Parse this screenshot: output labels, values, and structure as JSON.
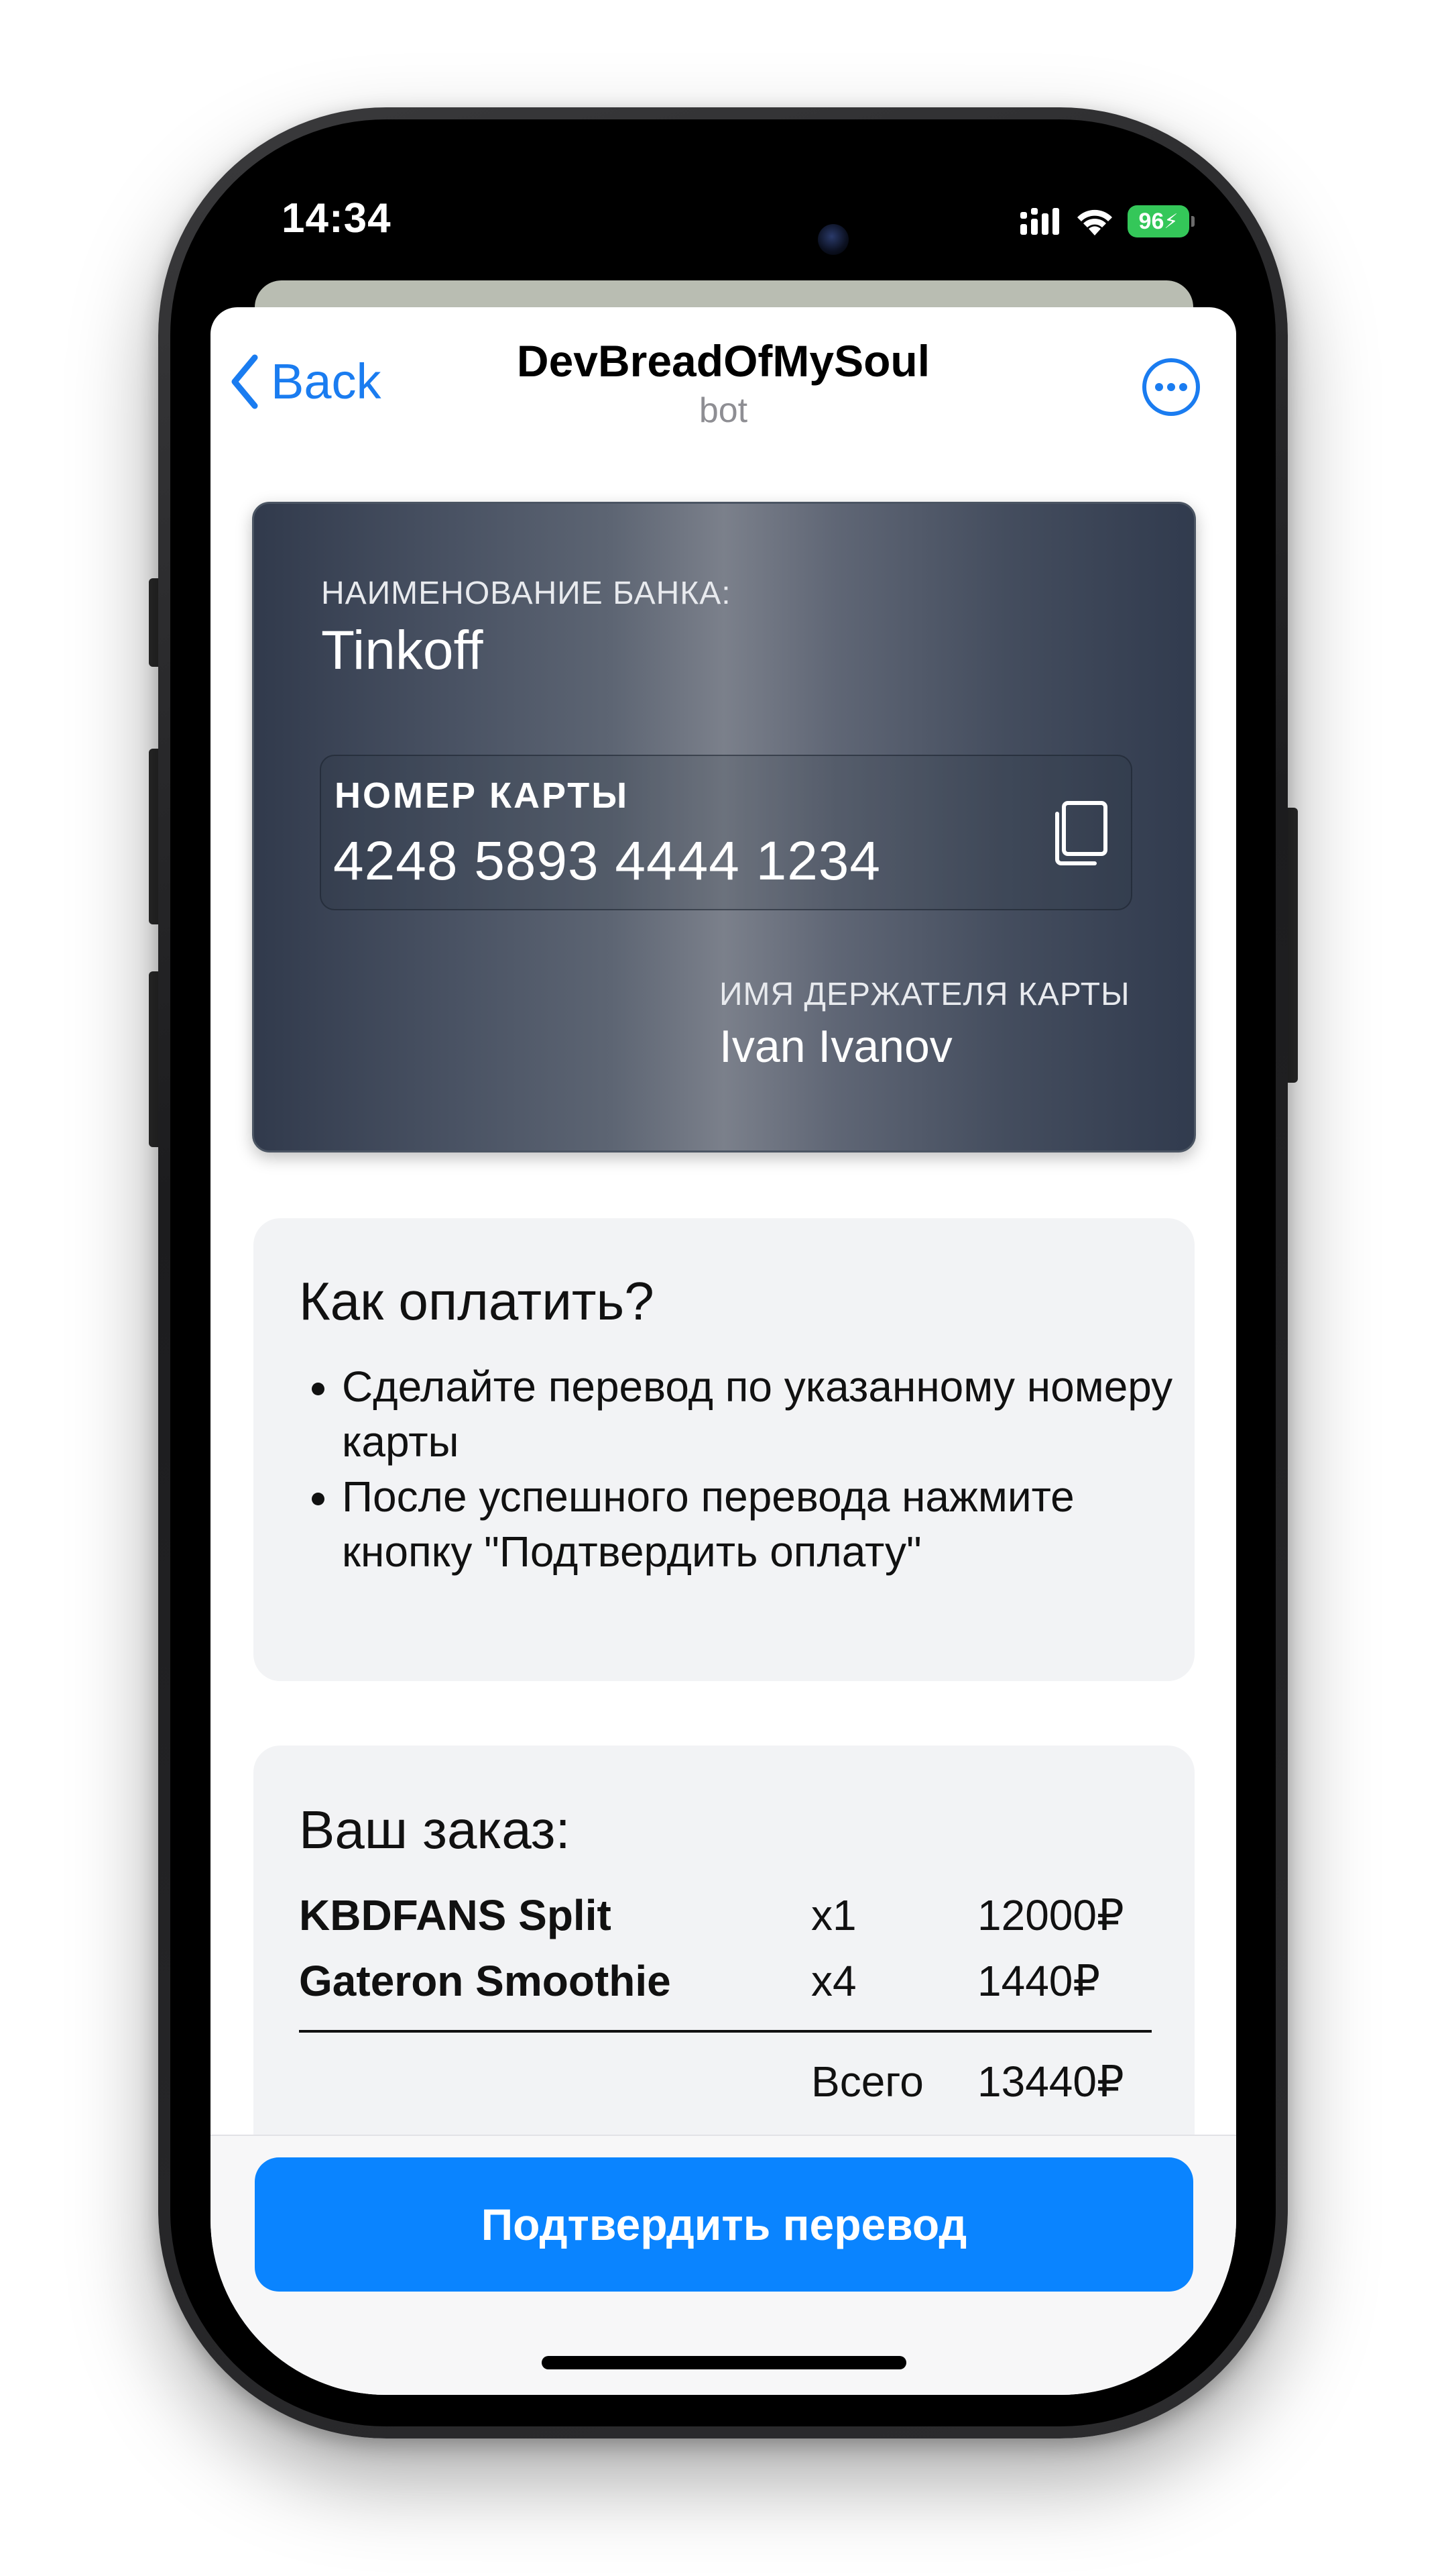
{
  "status_bar": {
    "time": "14:34",
    "battery": "96"
  },
  "header": {
    "back_label": "Back",
    "title": "DevBreadOfMySoul",
    "subtitle": "bot"
  },
  "card": {
    "bank_label": "НАИМЕНОВАНИЕ БАНКА:",
    "bank_name": "Tinkoff",
    "number_label": "НОМЕР КАРТЫ",
    "number": "4248 5893 4444 1234",
    "holder_label": "ИМЯ ДЕРЖАТЕЛЯ КАРТЫ",
    "holder_name": "Ivan Ivanov"
  },
  "how_to_pay": {
    "title": "Как оплатить?",
    "steps": [
      "Сделайте перевод по указанному номеру карты",
      "После успешного перевода нажмите кнопку \"Подтвердить оплату\""
    ]
  },
  "order": {
    "title": "Ваш заказ:",
    "items": [
      {
        "name": "KBDFANS Split",
        "qty": "x1",
        "price": "12000₽"
      },
      {
        "name": "Gateron Smoothie",
        "qty": "x4",
        "price": "1440₽"
      }
    ],
    "total_label": "Всего",
    "total_value": "13440₽"
  },
  "confirm_button": "Подтвердить перевод",
  "colors": {
    "accent": "#0a84ff",
    "link": "#1a7cf0",
    "battery": "#34c759",
    "box_bg": "#f2f3f5"
  },
  "icons": {
    "back": "chevron-left-icon",
    "more": "ellipsis-circle-icon",
    "copy": "copy-icon",
    "signal": "cellular-signal-icon",
    "wifi": "wifi-icon",
    "battery": "battery-icon"
  }
}
